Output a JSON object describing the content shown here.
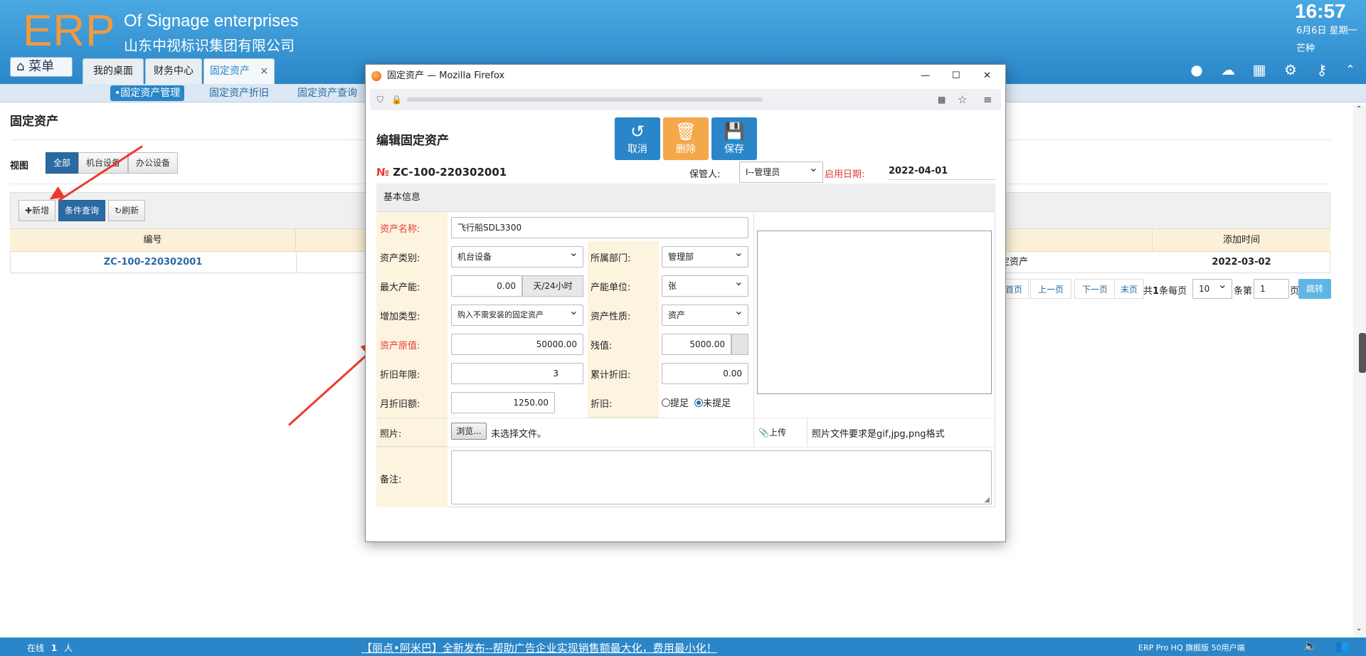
{
  "header": {
    "logo": "ERP",
    "company_en": "Of Signage enterprises",
    "company_cn": "山东中视标识集团有限公司",
    "time": "16:57",
    "date": "6月6日 星期一",
    "solar_term": "芒种",
    "menu_label": "菜单",
    "tabs": [
      {
        "label": "我的桌面"
      },
      {
        "label": "财务中心"
      },
      {
        "label": "固定资产",
        "close": "×"
      }
    ]
  },
  "subnav": {
    "items": [
      "•固定资产管理",
      "固定资产折旧",
      "固定资产查询"
    ]
  },
  "page": {
    "title": "固定资产",
    "view_label": "视图",
    "view_buttons": [
      "全部",
      "机台设备",
      "办公设备"
    ],
    "toolbar": {
      "add": "新增",
      "query": "条件查询",
      "refresh": "刷新"
    },
    "table": {
      "headers": [
        "编号",
        "添加时间"
      ],
      "row": {
        "code": "ZC-100-220302001",
        "type_tail": "定资产",
        "added": "2022-03-02"
      }
    },
    "pager": {
      "first": "首页",
      "prev": "上一页",
      "next": "下一页",
      "last": "末页",
      "total_prefix": "共",
      "total": "1",
      "total_suffix": "条每页",
      "per_page": "10",
      "page_prefix": "条第",
      "page": "1",
      "page_suffix": "页",
      "go": "跳转"
    }
  },
  "footer": {
    "online_label": "在线",
    "online_count": "1",
    "online_unit": "人",
    "marquee": "【丽点•阿米巴】全新发布--帮助广告企业实现销售额最大化，费用最小化！",
    "edition": "ERP Pro HQ 旗舰版 50用户端"
  },
  "dialog": {
    "window_title": "固定资产 — Mozilla Firefox",
    "window_controls": {
      "min": "—",
      "max": "☐",
      "close": "✕"
    },
    "form_title": "编辑固定资产",
    "actions": {
      "cancel": "取消",
      "delete": "删除",
      "save": "保存"
    },
    "no_symbol": "№",
    "asset_no": "ZC-100-220302001",
    "keeper_label": "保管人:",
    "keeper_value": "I--管理员",
    "start_label": "启用日期:",
    "start_value": "2022-04-01",
    "section_title": "基本信息",
    "fields": {
      "name_label": "资产名称:",
      "name_value": "飞行船SDL3300",
      "category_label": "资产类别:",
      "category_value": "机台设备",
      "dept_label": "所属部门:",
      "dept_value": "管理部",
      "capacity_label": "最大产能:",
      "capacity_value": "0.00",
      "capacity_unit": "天/24小时",
      "cap_unit_label": "产能单位:",
      "cap_unit_value": "张",
      "add_type_label": "增加类型:",
      "add_type_value": "购入不需安装的固定资产",
      "nature_label": "资产性质:",
      "nature_value": "资产",
      "original_label": "资产原值:",
      "original_value": "50000.00",
      "residual_label": "残值:",
      "residual_value": "5000.00",
      "years_label": "折旧年限:",
      "years_value": "3",
      "accum_label": "累计折旧:",
      "accum_value": "0.00",
      "monthly_label": "月折旧额:",
      "monthly_value": "1250.00",
      "depr_label": "折旧:",
      "depr_opt1": "提足",
      "depr_opt2": "未提足",
      "photo_label": "照片:",
      "browse": "浏览...",
      "no_file": "未选择文件。",
      "upload": "上传",
      "photo_hint": "照片文件要求是gif,jpg,png格式",
      "remark_label": "备注:"
    }
  },
  "colors": {
    "accent": "#2a86c8",
    "logo": "#f39a3c",
    "required": "#e53a3a",
    "arrow": "#ec3a2c"
  }
}
